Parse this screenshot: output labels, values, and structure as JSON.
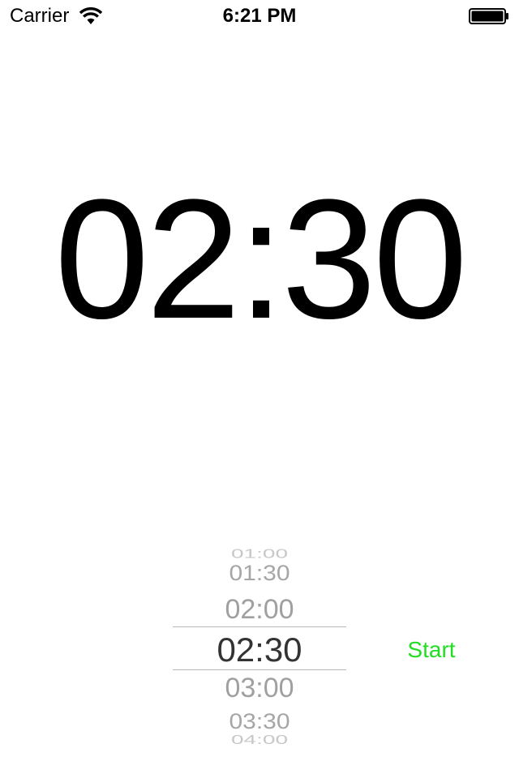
{
  "status_bar": {
    "carrier": "Carrier",
    "time": "6:21 PM",
    "icons": [
      "wifi-icon",
      "battery-icon"
    ]
  },
  "timer": {
    "display": "02:30"
  },
  "picker": {
    "options": [
      "01:00",
      "01:30",
      "02:00",
      "02:30",
      "03:00",
      "03:30",
      "04:00"
    ],
    "selected": "02:30"
  },
  "controls": {
    "start_label": "Start"
  },
  "colors": {
    "start": "#22dd22",
    "selected_text": "#333333",
    "unselected_text": "#a0a0a0",
    "background": "#ffffff"
  }
}
